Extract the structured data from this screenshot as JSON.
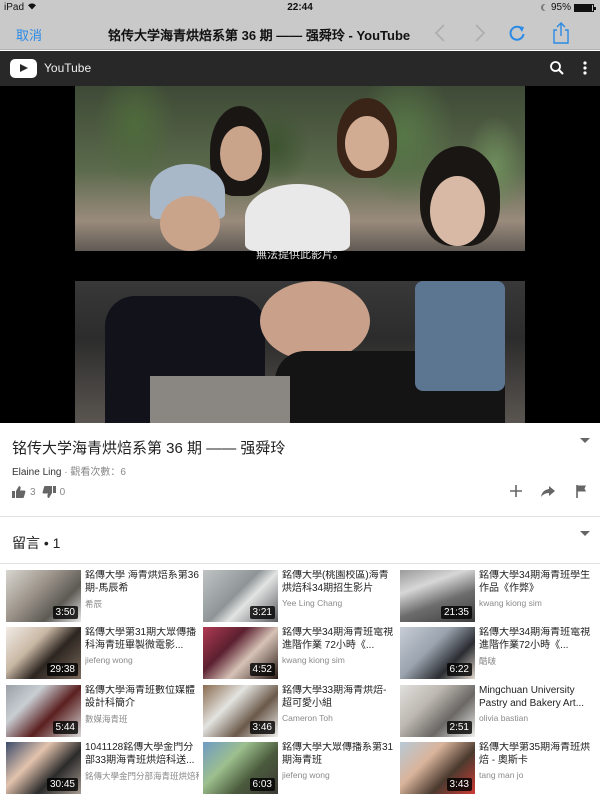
{
  "status_bar": {
    "device": "iPad",
    "time": "22:44",
    "battery": "95%",
    "battery_level": 0.95
  },
  "safari": {
    "cancel_label": "取消",
    "page_title": "铭传大学海青烘焙系第 36 期 —— 强舜玲 - YouTube",
    "icons": [
      "back-icon",
      "forward-icon",
      "reload-icon",
      "share-icon"
    ]
  },
  "youtube_header": {
    "brand": "YouTube",
    "icons": [
      "youtube-logo-icon",
      "search-icon",
      "more-vert-icon"
    ]
  },
  "player": {
    "error_message": "無法提供此影片。"
  },
  "video": {
    "title": "铭传大学海青烘焙系第 36 期 —— 强舜玲",
    "channel": "Elaine Ling",
    "separator": " · ",
    "views": "觀看次數：6",
    "likes": "3",
    "dislikes": "0",
    "actions": [
      "add-to-playlist",
      "share",
      "report"
    ]
  },
  "comments": {
    "label": "留言 • 1"
  },
  "related": [
    {
      "title": "銘傳大學 海青烘焙系第36期-馬辰希",
      "channel": "希辰",
      "duration": "3:50"
    },
    {
      "title": "銘傳大學(桃園校區)海青烘焙科34期招生影片",
      "channel": "Yee Ling Chang",
      "duration": "3:21"
    },
    {
      "title": "銘傳大學34期海青班學生作品《作弊》",
      "channel": "kwang kiong sim",
      "duration": "21:35"
    },
    {
      "title": "銘傳大學第31期大眾傳播科海青班畢製微電影...",
      "channel": "jiefeng wong",
      "duration": "29:38"
    },
    {
      "title": "銘傳大學34期海青班電視進階作業 72小時《...",
      "channel": "kwang kiong sim",
      "duration": "4:52"
    },
    {
      "title": "銘傳大學34期海青班電視進階作業72小時《...",
      "channel": "酷啵",
      "duration": "6:22"
    },
    {
      "title": "銘傳大學海青班數位媒體設計科簡介",
      "channel": "數媒海青班",
      "duration": "5:44"
    },
    {
      "title": "銘傳大學33期海青烘焙-超可愛小組",
      "channel": "Cameron Toh",
      "duration": "3:46"
    },
    {
      "title": "Mingchuan University Pastry and Bakery Art...",
      "channel": "olivia bastian",
      "duration": "2:51"
    },
    {
      "title": "1041128銘傳大學金門分部33期海青班烘焙科送...",
      "channel": "銘傳大學金門分部海青班烘焙科",
      "duration": "30:45"
    },
    {
      "title": "銘傳大學大眾傳播系第31期海青班",
      "channel": "jiefeng wong",
      "duration": "6:03"
    },
    {
      "title": "銘傳大學第35期海青班烘焙 - 奧斯卡",
      "channel": "tang man jo",
      "duration": "3:43"
    }
  ],
  "colors": {
    "ios_blue": "#2a8ae6",
    "chrome_gray": "#c9c9c9",
    "yt_header": "#282828"
  }
}
